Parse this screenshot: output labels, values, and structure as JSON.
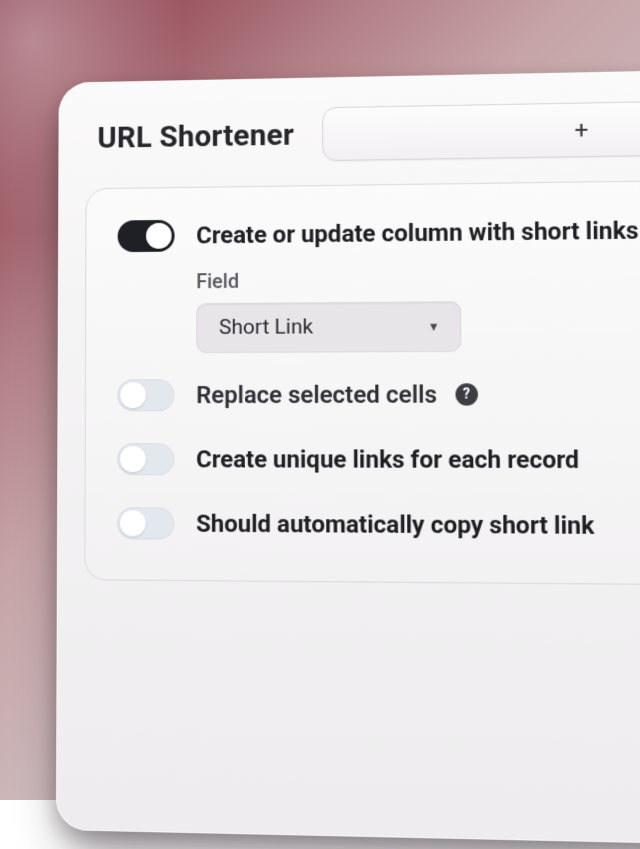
{
  "header": {
    "title": "URL Shortener",
    "action_label": "+"
  },
  "options": {
    "create_update": {
      "label": "Create or update column with short links",
      "on": true,
      "field_label": "Field",
      "field_value": "Short Link"
    },
    "replace": {
      "label": "Replace selected cells",
      "on": false,
      "help": "?"
    },
    "unique_links": {
      "label": "Create unique links for each record",
      "on": false
    },
    "auto_copy": {
      "label": "Should automatically copy short link",
      "on": false
    }
  }
}
